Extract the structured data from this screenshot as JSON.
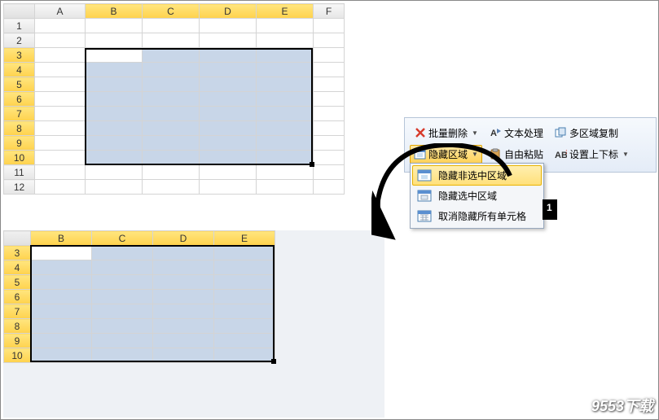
{
  "sheet1": {
    "cols": [
      "A",
      "B",
      "C",
      "D",
      "E",
      "F"
    ],
    "rows": [
      "1",
      "2",
      "3",
      "4",
      "5",
      "6",
      "7",
      "8",
      "9",
      "10",
      "11",
      "12"
    ],
    "sel_cols": [
      "B",
      "C",
      "D",
      "E"
    ],
    "sel_rows": [
      "3",
      "4",
      "5",
      "6",
      "7",
      "8",
      "9",
      "10"
    ]
  },
  "sheet2": {
    "cols": [
      "B",
      "C",
      "D",
      "E"
    ],
    "rows": [
      "3",
      "4",
      "5",
      "6",
      "7",
      "8",
      "9",
      "10"
    ]
  },
  "ribbon": {
    "row1": {
      "batch_delete": "批量删除",
      "text_process": "文本处理",
      "multi_area_copy": "多区域复制"
    },
    "row2": {
      "hide_area": "隐藏区域",
      "free_paste": "自由粘贴",
      "set_subscript": "设置上下标"
    }
  },
  "menu": {
    "hide_unselected": "隐藏非选中区域",
    "hide_selected": "隐藏选中区域",
    "unhide_all": "取消隐藏所有单元格"
  },
  "cursor_badge": "1",
  "watermark": "9553下载"
}
